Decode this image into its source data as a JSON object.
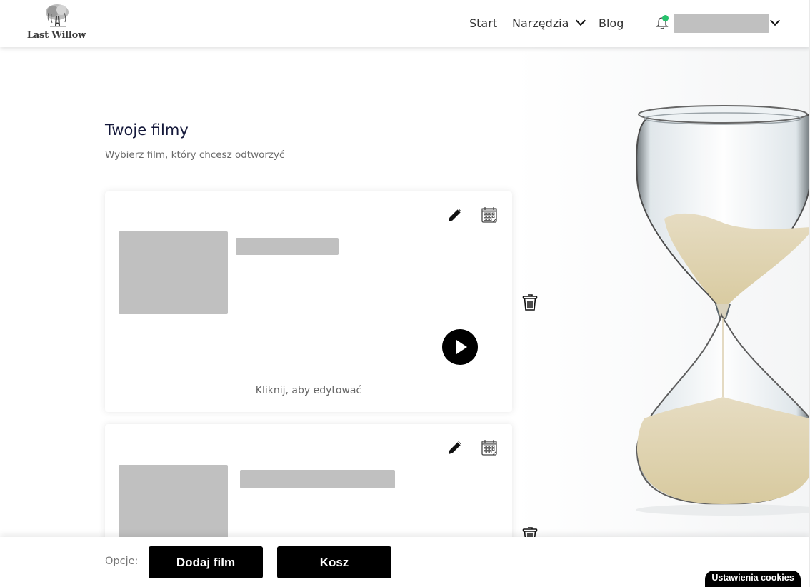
{
  "header": {
    "logo_text": "Last Willow",
    "nav": [
      {
        "label": "Start"
      },
      {
        "label": "Narzędzia",
        "has_dropdown": true
      },
      {
        "label": "Blog"
      }
    ],
    "notification_status_color": "#27c26c",
    "user_menu_has_dropdown": true
  },
  "main": {
    "title": "Twoje filmy",
    "subtitle": "Wybierz film, który chcesz odtworzyć",
    "cards": [
      {
        "hint": "Kliknij, aby edytować",
        "icons": [
          "edit-icon",
          "calendar-icon",
          "play-icon",
          "trash-icon"
        ]
      },
      {
        "hint": "",
        "icons": [
          "edit-icon",
          "calendar-icon",
          "trash-icon"
        ]
      }
    ]
  },
  "footer": {
    "options_label": "Opcje:",
    "add_button": "Dodaj film",
    "trash_button": "Kosz"
  },
  "cookies": {
    "label": "Ustawienia cookies"
  }
}
